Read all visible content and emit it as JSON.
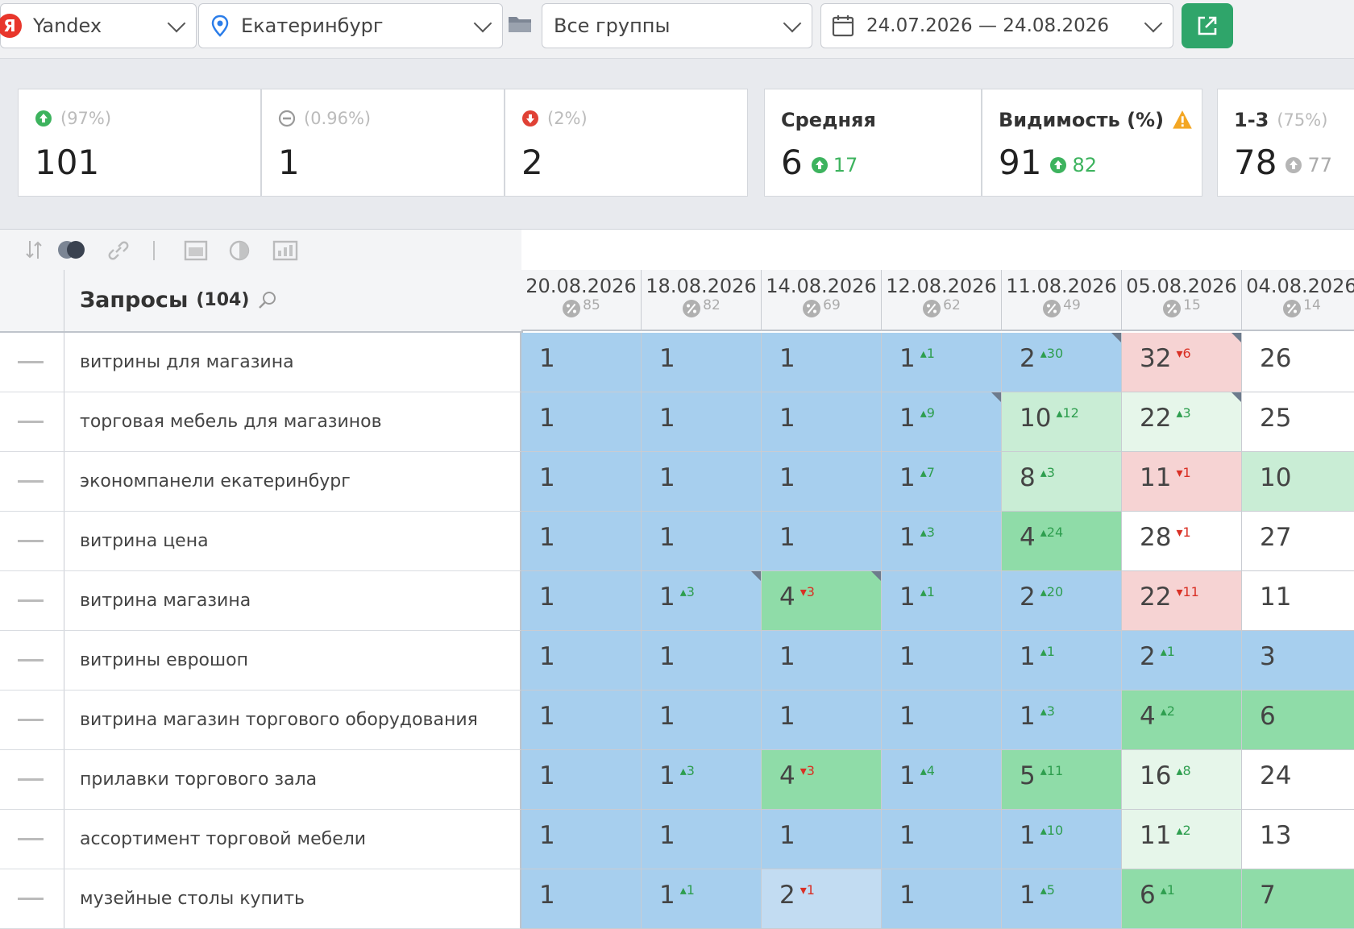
{
  "filters": {
    "engine": "Yandex",
    "engine_logo": "Я",
    "region": "Екатеринбург",
    "group": "Все группы",
    "date_range": "24.07.2026 — 24.08.2026"
  },
  "stats": {
    "up": {
      "pct": "(97%)",
      "value": "101"
    },
    "same": {
      "pct": "(0.96%)",
      "value": "1"
    },
    "down": {
      "pct": "(2%)",
      "value": "2"
    },
    "average": {
      "label": "Средняя",
      "value": "6",
      "delta": "17"
    },
    "visibility": {
      "label": "Видимость (%)",
      "value": "91",
      "delta": "82"
    },
    "top3": {
      "label": "1-3",
      "pct": "(75%)",
      "value": "78",
      "delta": "77"
    }
  },
  "table": {
    "queries_label": "Запросы",
    "queries_count": "(104)",
    "dates": [
      {
        "date": "20.08.2026",
        "visibility": "85"
      },
      {
        "date": "18.08.2026",
        "visibility": "82"
      },
      {
        "date": "14.08.2026",
        "visibility": "69"
      },
      {
        "date": "12.08.2026",
        "visibility": "62"
      },
      {
        "date": "11.08.2026",
        "visibility": "49"
      },
      {
        "date": "05.08.2026",
        "visibility": "15"
      },
      {
        "date": "04.08.2026",
        "visibility": "14"
      }
    ],
    "rows": [
      {
        "query": "витрины для магазина",
        "cells": [
          {
            "v": "1",
            "c": "",
            "dir": "",
            "bg": "blue"
          },
          {
            "v": "1",
            "c": "",
            "dir": "",
            "bg": "blue"
          },
          {
            "v": "1",
            "c": "",
            "dir": "",
            "bg": "blue"
          },
          {
            "v": "1",
            "c": "1",
            "dir": "up",
            "bg": "blue"
          },
          {
            "v": "2",
            "c": "30",
            "dir": "up",
            "bg": "blue",
            "corner": true
          },
          {
            "v": "32",
            "c": "6",
            "dir": "down",
            "bg": "pink",
            "corner": true
          },
          {
            "v": "26",
            "c": "",
            "dir": "",
            "bg": "white"
          }
        ]
      },
      {
        "query": "торговая мебель для магазинов",
        "cells": [
          {
            "v": "1",
            "c": "",
            "dir": "",
            "bg": "blue"
          },
          {
            "v": "1",
            "c": "",
            "dir": "",
            "bg": "blue"
          },
          {
            "v": "1",
            "c": "",
            "dir": "",
            "bg": "blue"
          },
          {
            "v": "1",
            "c": "9",
            "dir": "up",
            "bg": "blue",
            "corner": true
          },
          {
            "v": "10",
            "c": "12",
            "dir": "up",
            "bg": "lgreen"
          },
          {
            "v": "22",
            "c": "3",
            "dir": "up",
            "bg": "vlgreen",
            "corner": true
          },
          {
            "v": "25",
            "c": "",
            "dir": "",
            "bg": "white"
          }
        ]
      },
      {
        "query": "экономпанели екатеринбург",
        "cells": [
          {
            "v": "1",
            "c": "",
            "dir": "",
            "bg": "blue"
          },
          {
            "v": "1",
            "c": "",
            "dir": "",
            "bg": "blue"
          },
          {
            "v": "1",
            "c": "",
            "dir": "",
            "bg": "blue"
          },
          {
            "v": "1",
            "c": "7",
            "dir": "up",
            "bg": "blue"
          },
          {
            "v": "8",
            "c": "3",
            "dir": "up",
            "bg": "lgreen"
          },
          {
            "v": "11",
            "c": "1",
            "dir": "down",
            "bg": "pink"
          },
          {
            "v": "10",
            "c": "",
            "dir": "",
            "bg": "lgreen"
          }
        ]
      },
      {
        "query": "витрина цена",
        "cells": [
          {
            "v": "1",
            "c": "",
            "dir": "",
            "bg": "blue"
          },
          {
            "v": "1",
            "c": "",
            "dir": "",
            "bg": "blue"
          },
          {
            "v": "1",
            "c": "",
            "dir": "",
            "bg": "blue"
          },
          {
            "v": "1",
            "c": "3",
            "dir": "up",
            "bg": "blue"
          },
          {
            "v": "4",
            "c": "24",
            "dir": "up",
            "bg": "green"
          },
          {
            "v": "28",
            "c": "1",
            "dir": "down",
            "bg": "white"
          },
          {
            "v": "27",
            "c": "",
            "dir": "",
            "bg": "white"
          }
        ]
      },
      {
        "query": "витрина магазина",
        "cells": [
          {
            "v": "1",
            "c": "",
            "dir": "",
            "bg": "blue"
          },
          {
            "v": "1",
            "c": "3",
            "dir": "up",
            "bg": "blue",
            "corner": true
          },
          {
            "v": "4",
            "c": "3",
            "dir": "down",
            "bg": "green",
            "corner": true
          },
          {
            "v": "1",
            "c": "1",
            "dir": "up",
            "bg": "blue"
          },
          {
            "v": "2",
            "c": "20",
            "dir": "up",
            "bg": "blue"
          },
          {
            "v": "22",
            "c": "11",
            "dir": "down",
            "bg": "pink"
          },
          {
            "v": "11",
            "c": "",
            "dir": "",
            "bg": "white"
          }
        ]
      },
      {
        "query": "витрины еврошоп",
        "cells": [
          {
            "v": "1",
            "c": "",
            "dir": "",
            "bg": "blue"
          },
          {
            "v": "1",
            "c": "",
            "dir": "",
            "bg": "blue"
          },
          {
            "v": "1",
            "c": "",
            "dir": "",
            "bg": "blue"
          },
          {
            "v": "1",
            "c": "",
            "dir": "",
            "bg": "blue"
          },
          {
            "v": "1",
            "c": "1",
            "dir": "up",
            "bg": "blue"
          },
          {
            "v": "2",
            "c": "1",
            "dir": "up",
            "bg": "blue"
          },
          {
            "v": "3",
            "c": "",
            "dir": "",
            "bg": "blue"
          }
        ]
      },
      {
        "query": "витрина магазин торгового оборудования",
        "cells": [
          {
            "v": "1",
            "c": "",
            "dir": "",
            "bg": "blue"
          },
          {
            "v": "1",
            "c": "",
            "dir": "",
            "bg": "blue"
          },
          {
            "v": "1",
            "c": "",
            "dir": "",
            "bg": "blue"
          },
          {
            "v": "1",
            "c": "",
            "dir": "",
            "bg": "blue"
          },
          {
            "v": "1",
            "c": "3",
            "dir": "up",
            "bg": "blue"
          },
          {
            "v": "4",
            "c": "2",
            "dir": "up",
            "bg": "green"
          },
          {
            "v": "6",
            "c": "",
            "dir": "",
            "bg": "green"
          }
        ]
      },
      {
        "query": "прилавки торгового зала",
        "cells": [
          {
            "v": "1",
            "c": "",
            "dir": "",
            "bg": "blue"
          },
          {
            "v": "1",
            "c": "3",
            "dir": "up",
            "bg": "blue"
          },
          {
            "v": "4",
            "c": "3",
            "dir": "down",
            "bg": "green"
          },
          {
            "v": "1",
            "c": "4",
            "dir": "up",
            "bg": "blue"
          },
          {
            "v": "5",
            "c": "11",
            "dir": "up",
            "bg": "green"
          },
          {
            "v": "16",
            "c": "8",
            "dir": "up",
            "bg": "vlgreen"
          },
          {
            "v": "24",
            "c": "",
            "dir": "",
            "bg": "white"
          }
        ]
      },
      {
        "query": "ассортимент торговой мебели",
        "cells": [
          {
            "v": "1",
            "c": "",
            "dir": "",
            "bg": "blue"
          },
          {
            "v": "1",
            "c": "",
            "dir": "",
            "bg": "blue"
          },
          {
            "v": "1",
            "c": "",
            "dir": "",
            "bg": "blue"
          },
          {
            "v": "1",
            "c": "",
            "dir": "",
            "bg": "blue"
          },
          {
            "v": "1",
            "c": "10",
            "dir": "up",
            "bg": "blue"
          },
          {
            "v": "11",
            "c": "2",
            "dir": "up",
            "bg": "vlgreen"
          },
          {
            "v": "13",
            "c": "",
            "dir": "",
            "bg": "white"
          }
        ]
      },
      {
        "query": "музейные столы купить",
        "cells": [
          {
            "v": "1",
            "c": "",
            "dir": "",
            "bg": "blue"
          },
          {
            "v": "1",
            "c": "1",
            "dir": "up",
            "bg": "blue"
          },
          {
            "v": "2",
            "c": "1",
            "dir": "down",
            "bg": "lblue"
          },
          {
            "v": "1",
            "c": "",
            "dir": "",
            "bg": "blue"
          },
          {
            "v": "1",
            "c": "5",
            "dir": "up",
            "bg": "blue"
          },
          {
            "v": "6",
            "c": "1",
            "dir": "up",
            "bg": "green"
          },
          {
            "v": "7",
            "c": "",
            "dir": "",
            "bg": "green"
          }
        ]
      }
    ]
  }
}
